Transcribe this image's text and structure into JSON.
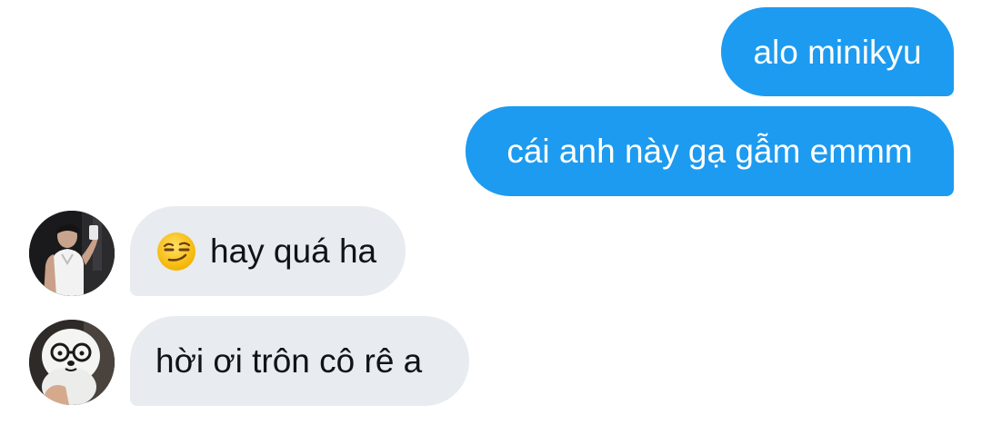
{
  "messages": [
    {
      "direction": "outgoing",
      "text": "alo minikyu"
    },
    {
      "direction": "outgoing",
      "text": "cái anh này gạ gẫm emmm"
    },
    {
      "direction": "incoming",
      "text": "hay quá ha",
      "emoji": "smirking-face-emoji",
      "avatar": "avatar-mirror-selfie"
    },
    {
      "direction": "incoming",
      "text": "hời ơi trôn cô rê a",
      "avatar": "avatar-plush-toy-with-glasses"
    }
  ],
  "colors": {
    "outgoing_bubble": "#1d9bf0",
    "incoming_bubble": "#e8ebef",
    "outgoing_text": "#ffffff",
    "incoming_text": "#0f1419",
    "background": "#ffffff"
  }
}
